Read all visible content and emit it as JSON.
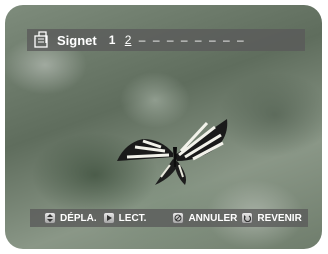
{
  "bookmark": {
    "title": "Signet",
    "slot_1": "1",
    "slot_2": "2",
    "empty_slots": [
      "–",
      "–",
      "–",
      "–",
      "–",
      "–",
      "–",
      "–"
    ]
  },
  "nav": {
    "move_label": "DÉPLA.",
    "play_label": "LECT.",
    "cancel_label": "ANNULER",
    "return_label": "REVENIR"
  },
  "icons": {
    "bookmark": "bookmark-icon",
    "move": "move-key-icon",
    "play": "play-key-icon",
    "cancel": "cancel-key-icon",
    "return": "return-key-icon"
  },
  "colors": {
    "overlay": "#5a5a5a",
    "text": "#ffffff",
    "key_face": "#d0d0d0"
  }
}
